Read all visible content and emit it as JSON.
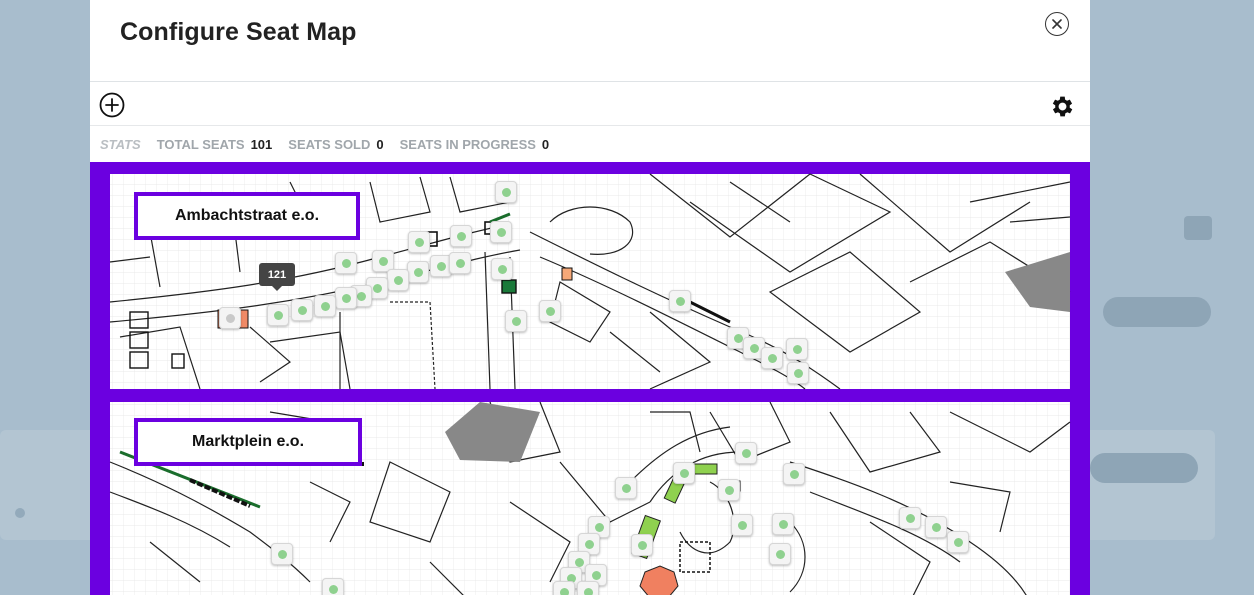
{
  "dialog": {
    "title": "Configure Seat Map"
  },
  "stats": {
    "heading": "STATS",
    "total_seats_label": "TOTAL SEATS",
    "total_seats_value": "101",
    "seats_sold_label": "SEATS SOLD",
    "seats_sold_value": "0",
    "seats_in_progress_label": "SEATS IN PROGRESS",
    "seats_in_progress_value": "0"
  },
  "map": {
    "area_1_label": "Ambachtstraat e.o.",
    "area_2_label": "Marktplein e.o.",
    "tooltip": "121"
  },
  "colors": {
    "frame": "#6b00e0",
    "seat_available": "#8fd18f"
  }
}
